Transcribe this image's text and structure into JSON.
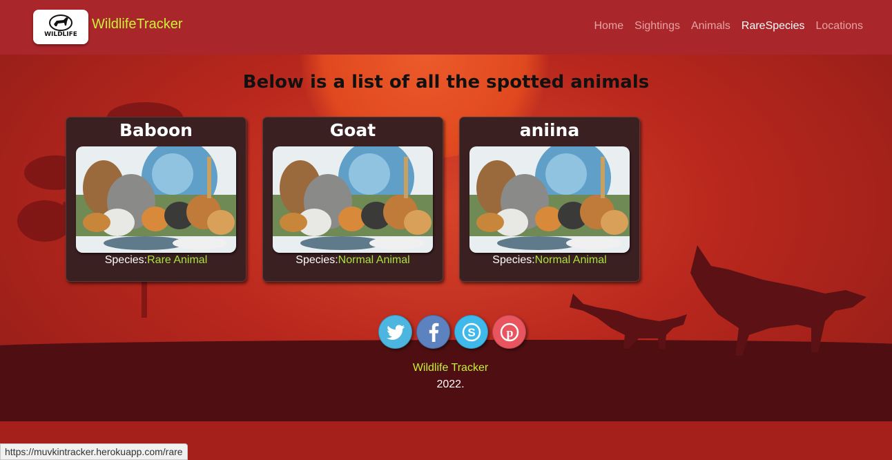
{
  "brand": {
    "logo_text": "WILDLIFE",
    "name": "WildlifeTracker"
  },
  "nav": {
    "items": [
      {
        "label": "Home"
      },
      {
        "label": "Sightings"
      },
      {
        "label": "Animals"
      },
      {
        "label": "RareSpecies"
      },
      {
        "label": "Locations"
      }
    ],
    "active": "RareSpecies"
  },
  "main": {
    "heading": "Below is a list of all the spotted animals",
    "species_prefix": "Species:",
    "cards": [
      {
        "name": "Baboon",
        "species": "Rare Animal"
      },
      {
        "name": "Goat",
        "species": "Normal Animal"
      },
      {
        "name": "aniina",
        "species": "Normal Animal"
      }
    ]
  },
  "social": [
    {
      "name": "twitter-icon",
      "color": "#4cb6e0"
    },
    {
      "name": "facebook-icon",
      "color": "#5d82c0"
    },
    {
      "name": "skype-icon",
      "color": "#3fb9ea"
    },
    {
      "name": "pinterest-icon",
      "color": "#e8555e"
    }
  ],
  "footer": {
    "name": "Wildlife Tracker",
    "year": "2022."
  },
  "status_bar": {
    "url": "https://muvkintracker.herokuapp.com/rare"
  },
  "colors": {
    "navbar": "#a9262a",
    "accent": "#cdf03a",
    "card": "#3b2022"
  }
}
